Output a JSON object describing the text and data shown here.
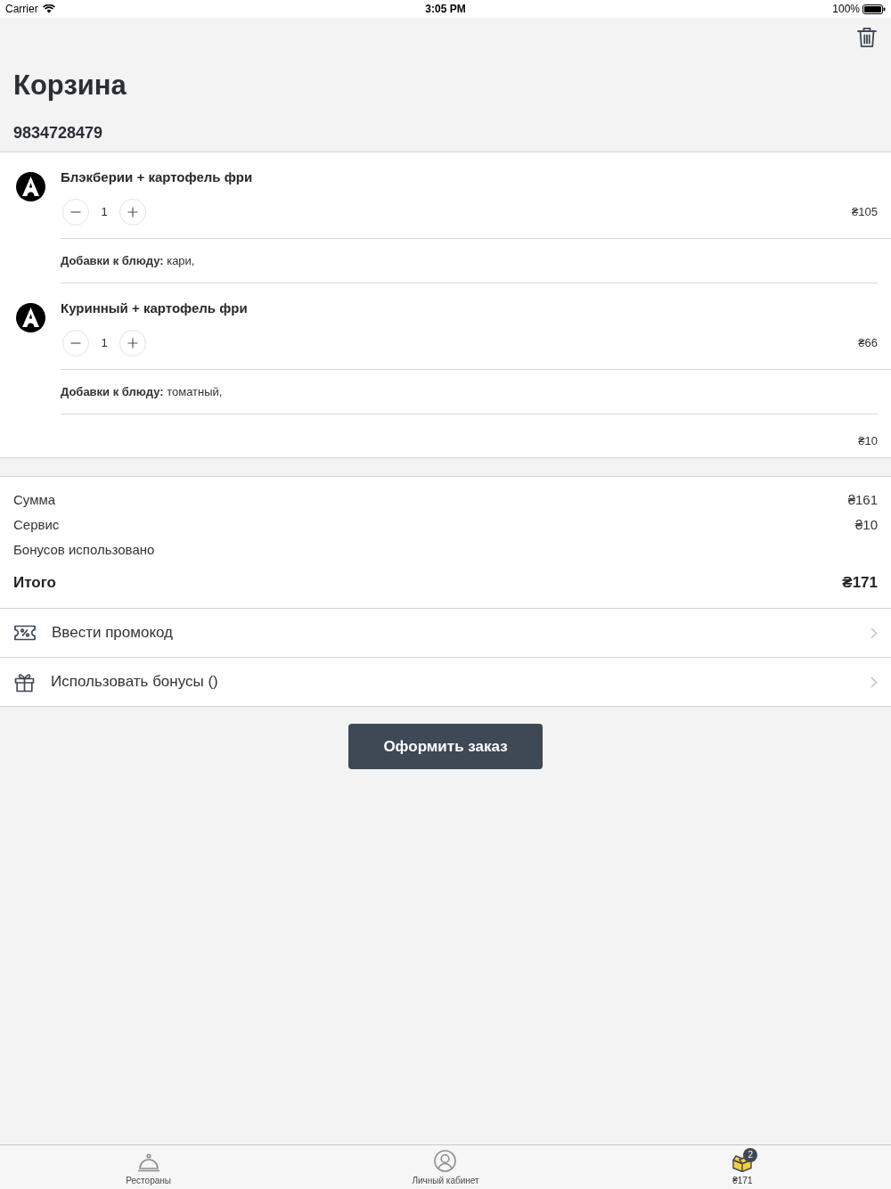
{
  "status_bar": {
    "carrier": "Carrier",
    "time": "3:05 PM",
    "battery": "100%"
  },
  "header": {
    "title": "Корзина",
    "phone": "9834728479"
  },
  "cart_items": [
    {
      "name": "Блэкберии + картофель фри",
      "quantity": "1",
      "price": "₴105",
      "addons": "**Добавки к блюду:** кари,"
    },
    {
      "name": "Куринный + картофель фри",
      "quantity": "1",
      "price": "₴66",
      "addons": "**Добавки к блюду:** томатный,"
    }
  ],
  "cart_footer": {
    "amount": "₴10"
  },
  "summary": [
    {
      "kind": "line",
      "label": "Сумма",
      "value": "₴161"
    },
    {
      "kind": "line",
      "label": "Сервис",
      "value": "₴10"
    },
    {
      "kind": "line",
      "label": "Бонусов использовано"
    },
    {
      "kind": "total",
      "label": "Итого",
      "value": "₴171"
    }
  ],
  "actions": [
    {
      "kind": "promo",
      "label": "Ввести промокод"
    },
    {
      "kind": "bonus",
      "label": "Использовать бонусы ()"
    }
  ],
  "checkout_button": {
    "label": "Оформить заказ"
  },
  "tab_bar": [
    {
      "kind": "restaurants",
      "label": "Рестораны",
      "selected": false
    },
    {
      "kind": "account",
      "label": "Личный кабинет",
      "selected": false
    },
    {
      "kind": "cart",
      "label": "₴171",
      "badge": "2",
      "selected": true
    }
  ]
}
